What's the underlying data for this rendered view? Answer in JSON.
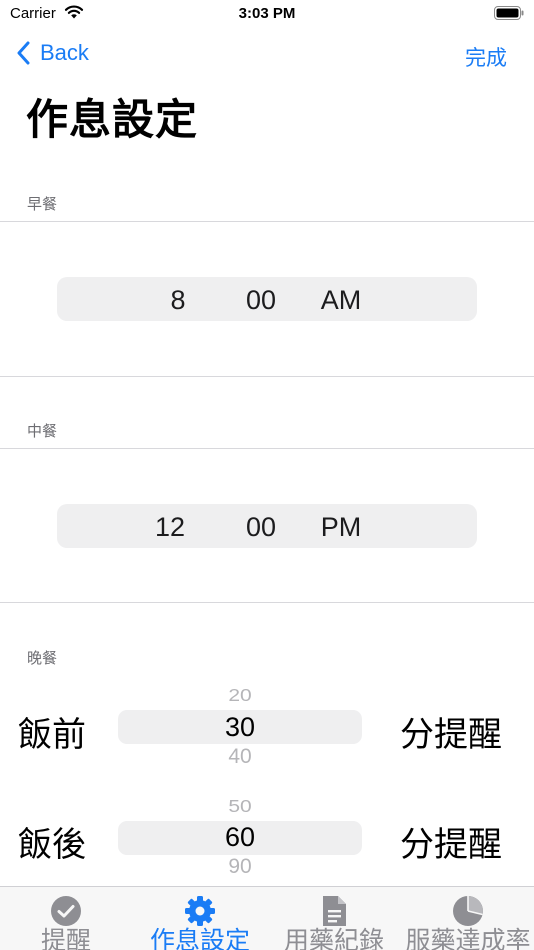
{
  "status": {
    "carrier": "Carrier",
    "time": "3:03 PM"
  },
  "nav": {
    "back_label": "Back",
    "done_label": "完成"
  },
  "page": {
    "title": "作息設定"
  },
  "breakfast": {
    "label": "早餐",
    "hour": "8",
    "minute": "00",
    "period": "AM"
  },
  "lunch": {
    "label": "中餐",
    "hour": "12",
    "minute": "00",
    "period": "PM"
  },
  "dinner": {
    "label": "晚餐",
    "before": {
      "label": "飯前",
      "above": "20",
      "value": "30",
      "below": "40",
      "suffix": "分提醒"
    },
    "after": {
      "label": "飯後",
      "above": "50",
      "value": "60",
      "below": "90",
      "suffix": "分提醒"
    }
  },
  "tabs": [
    {
      "label": "提醒",
      "icon": "check-circle-icon"
    },
    {
      "label": "作息設定",
      "icon": "gear-icon"
    },
    {
      "label": "用藥紀錄",
      "icon": "document-icon"
    },
    {
      "label": "服藥達成率",
      "icon": "pie-chart-icon"
    }
  ],
  "colors": {
    "accent": "#1a7cf5",
    "inactive": "#8e8e93"
  }
}
